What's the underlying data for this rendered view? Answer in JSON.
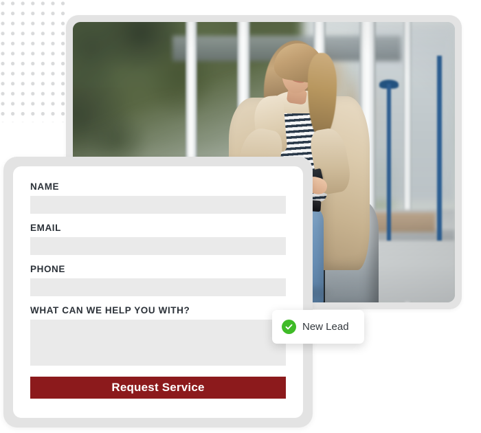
{
  "form": {
    "fields": [
      {
        "label": "NAME",
        "value": "",
        "placeholder": "",
        "name": "name"
      },
      {
        "label": "EMAIL",
        "value": "",
        "placeholder": "",
        "name": "email"
      },
      {
        "label": "PHONE",
        "value": "",
        "placeholder": "",
        "name": "phone"
      }
    ],
    "message_field": {
      "label": "WHAT CAN WE HELP YOU WITH?",
      "value": "",
      "placeholder": ""
    },
    "submit_label": "Request Service"
  },
  "toast": {
    "icon": "check-circle-icon",
    "label": "New Lead"
  },
  "photo": {
    "alt": "Woman in tan trench coat and blue jeans looking at her phone while leaning against a car",
    "icon": "hero-photo"
  },
  "colors": {
    "accent": "#8c1a1c",
    "success": "#3fbb27",
    "card_frame": "#e3e3e3",
    "input_bg": "#eaeaea",
    "label_text": "#2b3138",
    "dot_grid": "#d9dadb"
  }
}
